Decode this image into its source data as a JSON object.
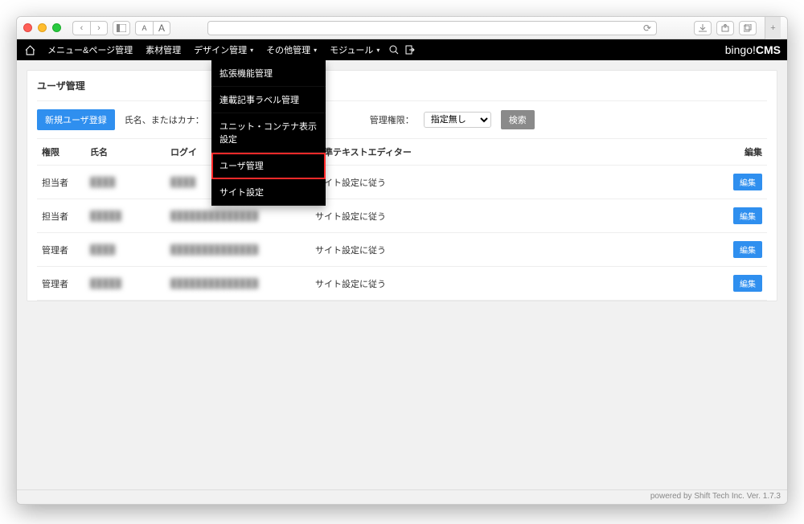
{
  "browser": {
    "back": "‹",
    "forward": "›",
    "font_small": "A",
    "font_large": "A",
    "reload": "⟳",
    "share": "⇧",
    "tabs": "⧉",
    "plus": "+"
  },
  "menubar": {
    "items": [
      {
        "label": "メニュー&ページ管理",
        "caret": false
      },
      {
        "label": "素材管理",
        "caret": false
      },
      {
        "label": "デザイン管理",
        "caret": true
      },
      {
        "label": "その他管理",
        "caret": true
      },
      {
        "label": "モジュール",
        "caret": true
      }
    ],
    "brand_prefix": "bingo!",
    "brand_suffix": "CMS",
    "dropdown": [
      {
        "label": "拡張機能管理",
        "highlight": false
      },
      {
        "label": "連載記事ラベル管理",
        "highlight": false
      },
      {
        "label": "ユニット・コンテナ表示設定",
        "highlight": false
      },
      {
        "label": "ユーザ管理",
        "highlight": true
      },
      {
        "label": "サイト設定",
        "highlight": false
      }
    ]
  },
  "page": {
    "title": "ユーザ管理",
    "new_user_btn": "新規ユーザ登録",
    "filter": {
      "name_label": "氏名、またはカナ：",
      "name_value": "",
      "role_label": "管理権限：",
      "role_selected": "指定無し",
      "search_btn": "検索"
    },
    "columns": {
      "role": "権限",
      "name": "氏名",
      "login": "ログイ",
      "editor": "標準テキストエディター",
      "edit": "編集"
    },
    "edit_btn": "編集",
    "rows": [
      {
        "role": "担当者",
        "name": "████",
        "login": "████",
        "editor": "サイト設定に従う"
      },
      {
        "role": "担当者",
        "name": "█████",
        "login": "██████████████",
        "editor": "サイト設定に従う"
      },
      {
        "role": "管理者",
        "name": "████",
        "login": "██████████████",
        "editor": "サイト設定に従う"
      },
      {
        "role": "管理者",
        "name": "█████",
        "login": "██████████████",
        "editor": "サイト設定に従う"
      }
    ]
  },
  "footer": "powered by Shift Tech Inc. Ver. 1.7.3"
}
